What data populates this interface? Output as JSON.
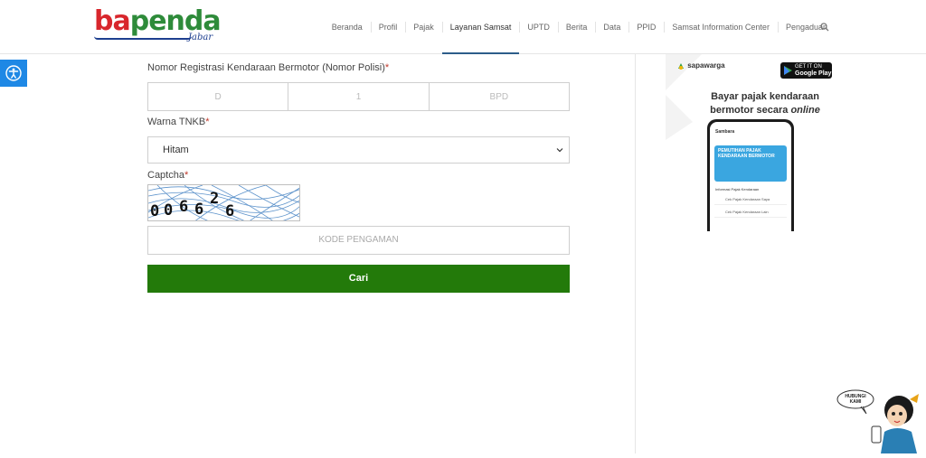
{
  "logo": {
    "brand_left": "ba",
    "brand_right": "penda",
    "sub": "Jabar"
  },
  "nav": {
    "items": [
      "Beranda",
      "Profil",
      "Pajak",
      "Layanan Samsat",
      "UPTD",
      "Berita",
      "Data",
      "PPID",
      "Samsat Information Center",
      "Pengaduan"
    ],
    "active": "Layanan Samsat",
    "search_icon": "search-icon"
  },
  "accessibility_icon": "accessibility-icon",
  "form": {
    "plate_label": "Nomor Registrasi Kendaraan Bermotor (Nomor Polisi)",
    "required_mark": "*",
    "plate_placeholders": [
      "D",
      "1",
      "BPD"
    ],
    "color_label": "Warna TNKB",
    "color_selected": "Hitam",
    "captcha_label": "Captcha",
    "captcha_digits": [
      "0",
      "0",
      "6",
      "6",
      "2",
      "6"
    ],
    "kode_placeholder": "KODE PENGAMAN",
    "submit_label": "Cari"
  },
  "ad": {
    "brand": "sapawarga",
    "store_top": "GET IT ON",
    "store_name": "Google Play",
    "headline_1": "Bayar pajak kendaraan",
    "headline_2": "bermotor secara",
    "headline_italic": "online",
    "app_title": "Sambara",
    "banner_text": "PEMUTIHAN PAJAK KENDARAAN BERMOTOR",
    "section_title": "Informasi Pajak Kendaraan",
    "rows": [
      "Cek Pajak Kendaraan Saya",
      "Cek Pajak Kendaraan Lain"
    ]
  },
  "mascot": {
    "bubble": "HUBUNGI KAMI"
  },
  "colors": {
    "submit_bg": "#237a0a",
    "accent_blue": "#1e88e5",
    "required": "#c0392b"
  }
}
